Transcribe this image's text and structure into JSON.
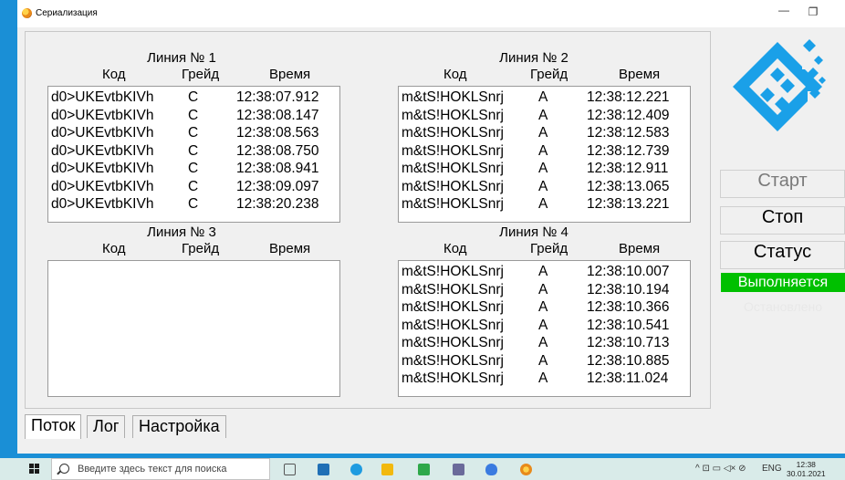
{
  "window": {
    "title": "Сериализация",
    "minimize_glyph": "—",
    "maximize_glyph": "❐"
  },
  "line1": {
    "title": "Линия № 1",
    "columns": [
      "Код",
      "Грейд",
      "Время"
    ],
    "rows": [
      {
        "code": "d0>UKEvtbKIVh",
        "grade": "C",
        "time": "12:38:07.912"
      },
      {
        "code": "d0>UKEvtbKIVh",
        "grade": "C",
        "time": "12:38:08.147"
      },
      {
        "code": "d0>UKEvtbKIVh",
        "grade": "C",
        "time": "12:38:08.563"
      },
      {
        "code": "d0>UKEvtbKIVh",
        "grade": "C",
        "time": "12:38:08.750"
      },
      {
        "code": "d0>UKEvtbKIVh",
        "grade": "C",
        "time": "12:38:08.941"
      },
      {
        "code": "d0>UKEvtbKIVh",
        "grade": "C",
        "time": "12:38:09.097"
      },
      {
        "code": "d0>UKEvtbKIVh",
        "grade": "C",
        "time": "12:38:20.238"
      }
    ]
  },
  "line2": {
    "title": "Линия № 2",
    "columns": [
      "Код",
      "Грейд",
      "Время"
    ],
    "rows": [
      {
        "code": "m&tS!HOKLSnrj",
        "grade": "A",
        "time": "12:38:12.221"
      },
      {
        "code": "m&tS!HOKLSnrj",
        "grade": "A",
        "time": "12:38:12.409"
      },
      {
        "code": "m&tS!HOKLSnrj",
        "grade": "A",
        "time": "12:38:12.583"
      },
      {
        "code": "m&tS!HOKLSnrj",
        "grade": "A",
        "time": "12:38:12.739"
      },
      {
        "code": "m&tS!HOKLSnrj",
        "grade": "A",
        "time": "12:38:12.911"
      },
      {
        "code": "m&tS!HOKLSnrj",
        "grade": "A",
        "time": "12:38:13.065"
      },
      {
        "code": "m&tS!HOKLSnrj",
        "grade": "A",
        "time": "12:38:13.221"
      }
    ]
  },
  "line3": {
    "title": "Линия № 3",
    "columns": [
      "Код",
      "Грейд",
      "Время"
    ],
    "rows": []
  },
  "line4": {
    "title": "Линия № 4",
    "columns": [
      "Код",
      "Грейд",
      "Время"
    ],
    "rows": [
      {
        "code": "m&tS!HOKLSnrj",
        "grade": "A",
        "time": "12:38:10.007"
      },
      {
        "code": "m&tS!HOKLSnrj",
        "grade": "A",
        "time": "12:38:10.194"
      },
      {
        "code": "m&tS!HOKLSnrj",
        "grade": "A",
        "time": "12:38:10.366"
      },
      {
        "code": "m&tS!HOKLSnrj",
        "grade": "A",
        "time": "12:38:10.541"
      },
      {
        "code": "m&tS!HOKLSnrj",
        "grade": "A",
        "time": "12:38:10.713"
      },
      {
        "code": "m&tS!HOKLSnrj",
        "grade": "A",
        "time": "12:38:10.885"
      },
      {
        "code": "m&tS!HOKLSnrj",
        "grade": "A",
        "time": "12:38:11.024"
      }
    ]
  },
  "tabs": [
    "Поток",
    "Лог",
    "Настройка"
  ],
  "active_tab": 0,
  "side": {
    "start_label": "Старт",
    "stop_label": "Стоп",
    "status_label": "Статус",
    "status_value": "Выполняется",
    "status_color": "#00c000",
    "faded_label": "Остановлено"
  },
  "logo_color": "#1aa0e8",
  "taskbar": {
    "search_placeholder": "Введите здесь текст для поиска",
    "lang": "ENG",
    "time": "12:38",
    "date": "30.01.2021",
    "tray_glyphs": "^ ⊡ ▭ ◁× ⊘"
  }
}
